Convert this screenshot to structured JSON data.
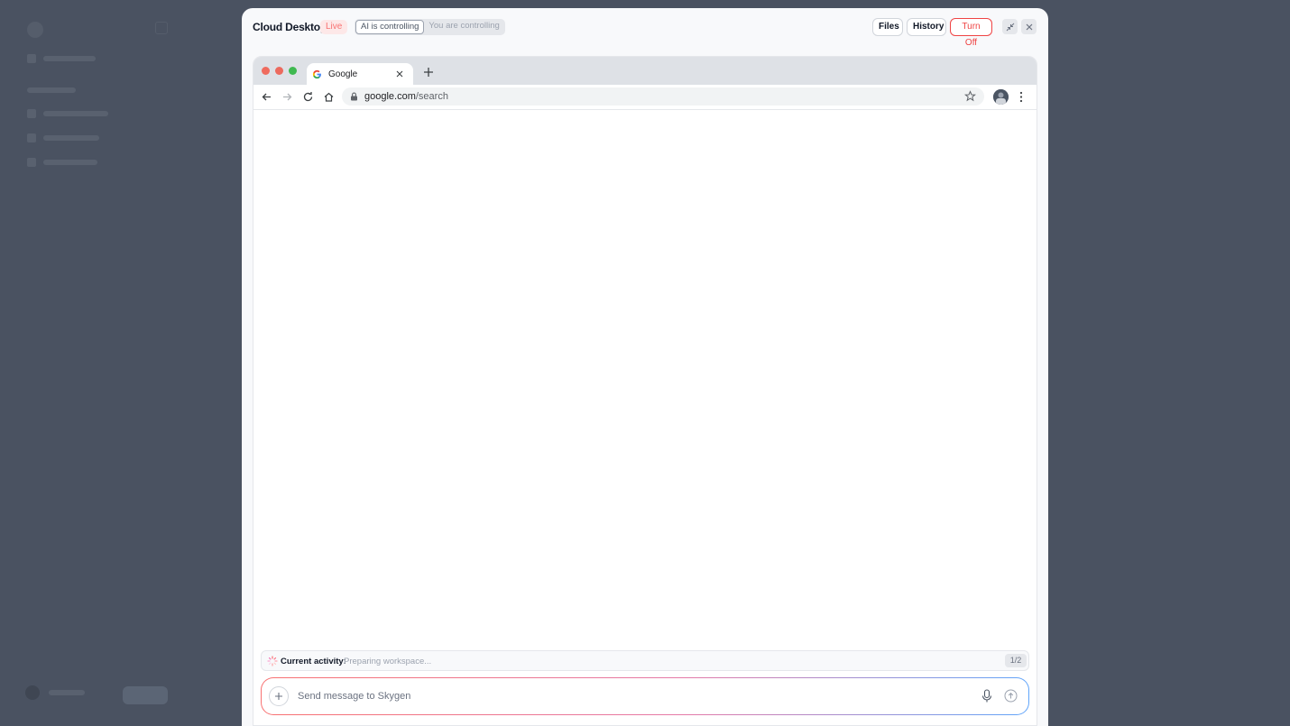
{
  "modal": {
    "title": "Cloud Desktop",
    "live_badge": "Live",
    "control_toggle": {
      "ai_label": "AI is controlling",
      "user_label": "You are controlling",
      "active": "ai"
    },
    "buttons": {
      "files": "Files",
      "history": "History",
      "turn_off": "Turn Off"
    },
    "icons": {
      "minimize": "collapse-icon",
      "close": "close-icon"
    }
  },
  "browser": {
    "tab": {
      "title": "Google",
      "favicon": "google-g-icon"
    },
    "url": {
      "domain": "google.com",
      "path": "/search"
    },
    "colors": {
      "traffic_red": "#ef6b5e",
      "traffic_yellow": "#ec6a5e",
      "traffic_green": "#3fb950"
    }
  },
  "activity": {
    "label": "Current activity:",
    "status": "Preparing workspace...",
    "count": "1/2"
  },
  "composer": {
    "placeholder": "Send message to Skygen"
  },
  "colors": {
    "accent_red": "#ef4444",
    "backdrop": "#4a5261",
    "gradient_start": "#f87171",
    "gradient_end": "#60a5fa"
  }
}
